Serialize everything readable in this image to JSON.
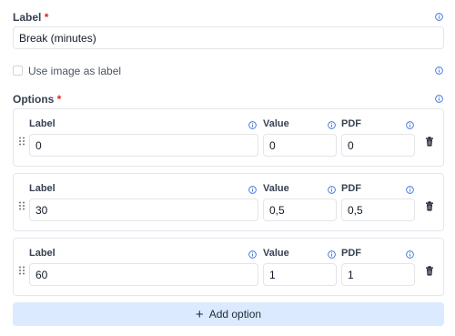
{
  "label_field": {
    "label": "Label",
    "required_mark": "*",
    "value": "Break (minutes)"
  },
  "use_image": {
    "label": "Use image as label",
    "checked": false
  },
  "options_section": {
    "label": "Options",
    "required_mark": "*",
    "column_labels": {
      "label": "Label",
      "value": "Value",
      "pdf": "PDF"
    },
    "options": [
      {
        "label": "0",
        "value": "0",
        "pdf": "0"
      },
      {
        "label": "30",
        "value": "0,5",
        "pdf": "0,5"
      },
      {
        "label": "60",
        "value": "1",
        "pdf": "1"
      }
    ]
  },
  "add_option": {
    "icon": "plus-icon",
    "label": "Add option"
  },
  "colors": {
    "accent": "#3b6fd9",
    "required": "#dc2626",
    "add_button_bg": "#dbeafe"
  }
}
